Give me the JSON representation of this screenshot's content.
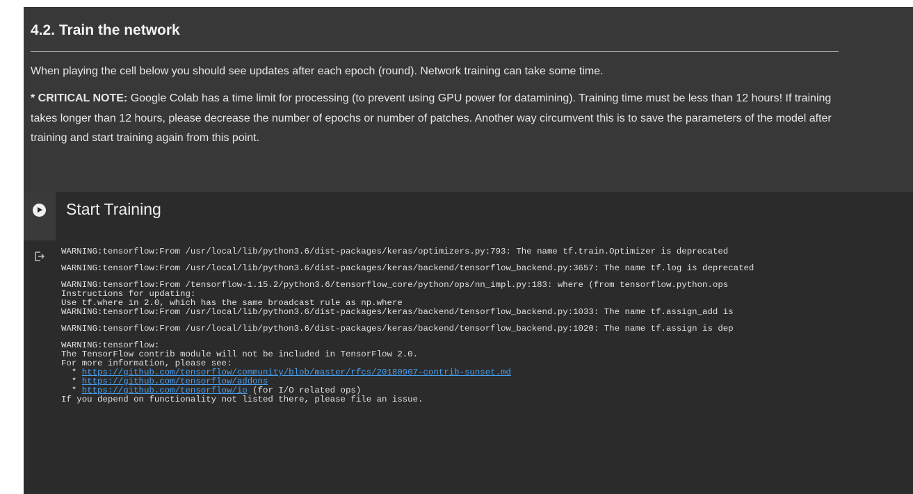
{
  "text_cell": {
    "heading": "4.2. Train the network",
    "paragraph_1": "When playing the cell below you should see updates after each epoch (round). Network training can take some time.",
    "critical_label": "* CRITICAL NOTE:",
    "critical_text": " Google Colab has a time limit for processing (to prevent using GPU power for datamining). Training time must be less than 12 hours! If training takes longer than 12 hours, please decrease the number of epochs or number of patches. Another way circumvent this is to save the parameters of the model after training and start training again from this point."
  },
  "code_cell": {
    "title": "Start Training",
    "run_icon": "play-circle-icon",
    "output_icon": "output-arrow-icon"
  },
  "output": {
    "line_1": "WARNING:tensorflow:From /usr/local/lib/python3.6/dist-packages/keras/optimizers.py:793: The name tf.train.Optimizer is deprecated",
    "line_2": "WARNING:tensorflow:From /usr/local/lib/python3.6/dist-packages/keras/backend/tensorflow_backend.py:3657: The name tf.log is deprecated",
    "line_3": "WARNING:tensorflow:From /tensorflow-1.15.2/python3.6/tensorflow_core/python/ops/nn_impl.py:183: where (from tensorflow.python.ops",
    "line_4": "Instructions for updating:",
    "line_5": "Use tf.where in 2.0, which has the same broadcast rule as np.where",
    "line_6": "WARNING:tensorflow:From /usr/local/lib/python3.6/dist-packages/keras/backend/tensorflow_backend.py:1033: The name tf.assign_add is",
    "line_7": "WARNING:tensorflow:From /usr/local/lib/python3.6/dist-packages/keras/backend/tensorflow_backend.py:1020: The name tf.assign is dep",
    "line_8": "WARNING:tensorflow:",
    "line_9": "The TensorFlow contrib module will not be included in TensorFlow 2.0.",
    "line_10": "For more information, please see:",
    "bullet": "  * ",
    "link_1": "https://github.com/tensorflow/community/blob/master/rfcs/20180907-contrib-sunset.md",
    "link_2": "https://github.com/tensorflow/addons",
    "link_3": "https://github.com/tensorflow/io",
    "link_3_suffix": " (for I/O related ops)",
    "line_last": "If you depend on functionality not listed there, please file an issue."
  }
}
